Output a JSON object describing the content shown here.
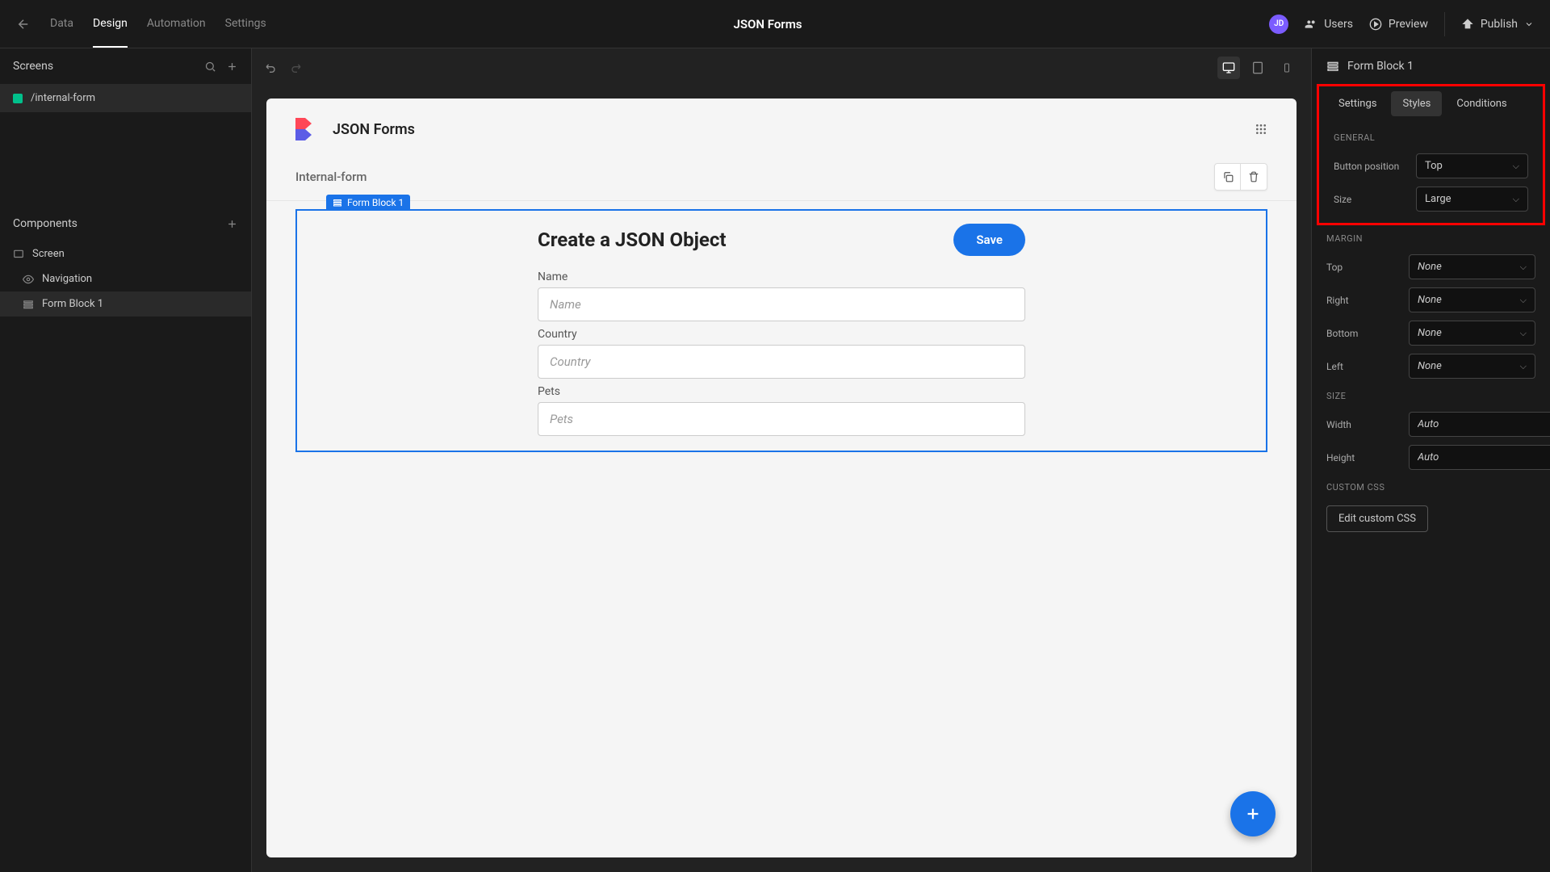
{
  "topbar": {
    "tabs": [
      "Data",
      "Design",
      "Automation",
      "Settings"
    ],
    "active_tab": 1,
    "app_title": "JSON Forms",
    "avatar": "JD",
    "users_label": "Users",
    "preview_label": "Preview",
    "publish_label": "Publish"
  },
  "left": {
    "screens_title": "Screens",
    "screens": [
      {
        "name": "/internal-form"
      }
    ],
    "components_title": "Components",
    "components": [
      {
        "name": "Screen",
        "icon": "screen"
      },
      {
        "name": "Navigation",
        "icon": "eye"
      },
      {
        "name": "Form Block 1",
        "icon": "form",
        "selected": true
      }
    ]
  },
  "canvas": {
    "brand": "JSON Forms",
    "screen_name": "Internal-form",
    "selected_tag": "Form Block 1",
    "form": {
      "title": "Create a JSON Object",
      "save_label": "Save",
      "fields": [
        {
          "label": "Name",
          "placeholder": "Name"
        },
        {
          "label": "Country",
          "placeholder": "Country"
        },
        {
          "label": "Pets",
          "placeholder": "Pets"
        }
      ]
    }
  },
  "right": {
    "block_name": "Form Block 1",
    "tabs": [
      "Settings",
      "Styles",
      "Conditions"
    ],
    "active_tab": 1,
    "general_title": "GENERAL",
    "general": [
      {
        "label": "Button position",
        "value": "Top"
      },
      {
        "label": "Size",
        "value": "Large"
      }
    ],
    "margin_title": "MARGIN",
    "margin": [
      {
        "label": "Top",
        "value": "None"
      },
      {
        "label": "Right",
        "value": "None"
      },
      {
        "label": "Bottom",
        "value": "None"
      },
      {
        "label": "Left",
        "value": "None"
      }
    ],
    "size_title": "SIZE",
    "size": [
      {
        "label": "Width",
        "value": "Auto"
      },
      {
        "label": "Height",
        "value": "Auto"
      }
    ],
    "css_title": "CUSTOM CSS",
    "css_button": "Edit custom CSS"
  }
}
